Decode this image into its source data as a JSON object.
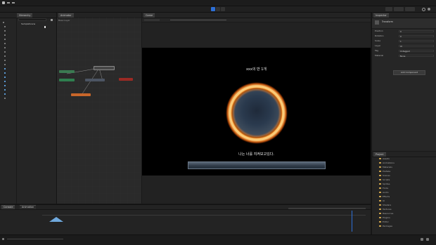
{
  "toolbar": {
    "play_icon": "play-icon",
    "pause_icon": "pause-icon",
    "step_icon": "step-icon"
  },
  "hierarchy": {
    "tab": "Hierarchy",
    "search_placeholder": "Search",
    "root": "SampleScene"
  },
  "graph": {
    "tab": "Animator",
    "layer_label": "Base Layer"
  },
  "game": {
    "tab": "Game",
    "title_text": "xxx의 반 1개",
    "subtitle_text": "나는 너를 지켜보고있다."
  },
  "inspector": {
    "tab": "Inspector",
    "component_title": "Transform",
    "add_component": "Add Component",
    "rows": [
      {
        "label": "Position",
        "value": "0"
      },
      {
        "label": "Rotation",
        "value": "0"
      },
      {
        "label": "Scale",
        "value": "1"
      },
      {
        "label": "Layer",
        "value": "UI"
      },
      {
        "label": "Tag",
        "value": "Untagged"
      },
      {
        "label": "Material",
        "value": "None"
      }
    ]
  },
  "project": {
    "tab": "Project",
    "folders": [
      "Assets",
      "Animations",
      "Materials",
      "Prefabs",
      "Scenes",
      "Scripts",
      "Sprites",
      "Fonts",
      "Audio",
      "Effects",
      "UI",
      "Shaders",
      "Textures",
      "Resources",
      "Plugins",
      "Editor",
      "Packages"
    ]
  },
  "console": {
    "tab": "Console",
    "tab2": "Animation"
  },
  "colors": {
    "accent": "#2d6fd6",
    "ring_outer": "#ff7a18",
    "ring_inner": "#ffd27a",
    "bar": "#3d4a5a"
  }
}
